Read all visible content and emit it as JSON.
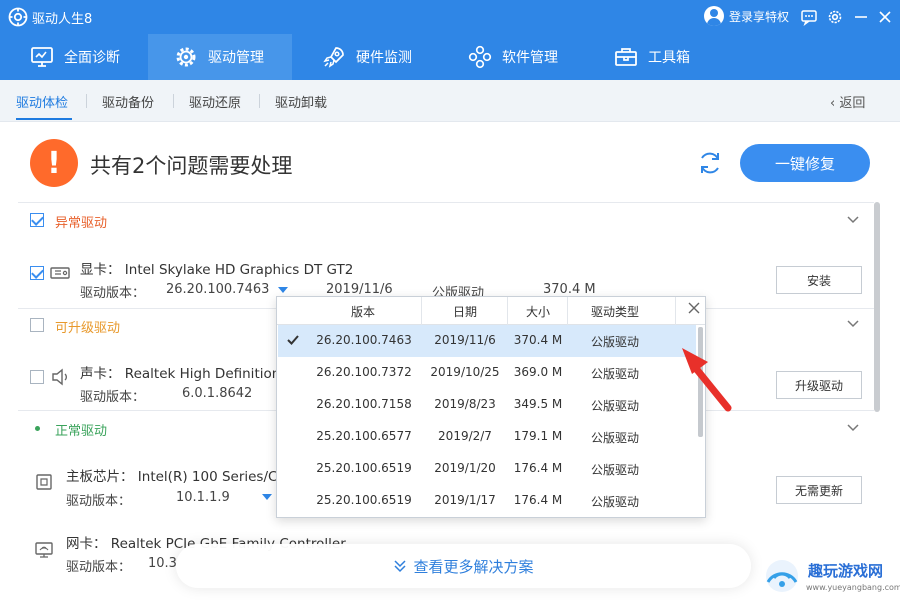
{
  "app": {
    "title": "驱动人生8",
    "login_label": "登录享特权"
  },
  "main_tabs": [
    {
      "label": "全面诊断",
      "icon": "monitor-icon"
    },
    {
      "label": "驱动管理",
      "icon": "gear-icon"
    },
    {
      "label": "硬件监测",
      "icon": "rocket-icon"
    },
    {
      "label": "软件管理",
      "icon": "apps-icon"
    },
    {
      "label": "工具箱",
      "icon": "toolbox-icon"
    }
  ],
  "active_main_tab": "驱动管理",
  "sub_tabs": [
    {
      "label": "驱动体检"
    },
    {
      "label": "驱动备份"
    },
    {
      "label": "驱动还原"
    },
    {
      "label": "驱动卸载"
    }
  ],
  "active_sub_tab": "驱动体检",
  "back_label": "返回",
  "summary": {
    "title": "共有2个问题需要处理",
    "warning_mark": "!",
    "fix_button": "一键修复"
  },
  "sections": {
    "abnormal": {
      "label": "异常驱动",
      "color": "#e8612c"
    },
    "upgradable": {
      "label": "可升级驱动",
      "color": "#e8992c"
    },
    "normal": {
      "label": "正常驱动",
      "color": "#3aa35b"
    }
  },
  "devices": {
    "graphics": {
      "label": "显卡：",
      "name": "Intel Skylake HD Graphics DT GT2",
      "version_label": "驱动版本：",
      "version": "26.20.100.7463",
      "date": "2019/11/6",
      "type": "公版驱动",
      "size": "370.4 M",
      "action": "安装"
    },
    "sound": {
      "label": "声卡：",
      "name": "Realtek High Definition",
      "version_label": "驱动版本：",
      "version": "6.0.1.8642",
      "action": "升级驱动"
    },
    "chipset": {
      "label": "主板芯片：",
      "name": "Intel(R) 100 Series/C",
      "version_label": "驱动版本：",
      "version": "10.1.1.9",
      "action": "无需更新"
    },
    "network": {
      "label": "网卡：",
      "name": "Realtek PCIe GbE Family Controller",
      "version_label": "驱动版本：",
      "version": "10.3"
    }
  },
  "version_popup": {
    "headers": [
      "版本",
      "日期",
      "大小",
      "驱动类型"
    ],
    "rows": [
      {
        "version": "26.20.100.7463",
        "date": "2019/11/6",
        "size": "370.4 M",
        "type": "公版驱动",
        "selected": true
      },
      {
        "version": "26.20.100.7372",
        "date": "2019/10/25",
        "size": "369.0 M",
        "type": "公版驱动",
        "selected": false
      },
      {
        "version": "26.20.100.7158",
        "date": "2019/8/23",
        "size": "349.5 M",
        "type": "公版驱动",
        "selected": false
      },
      {
        "version": "25.20.100.6577",
        "date": "2019/2/7",
        "size": "179.1 M",
        "type": "公版驱动",
        "selected": false
      },
      {
        "version": "25.20.100.6519",
        "date": "2019/1/20",
        "size": "176.4 M",
        "type": "公版驱动",
        "selected": false
      },
      {
        "version": "25.20.100.6519",
        "date": "2019/1/17",
        "size": "176.4 M",
        "type": "公版驱动",
        "selected": false
      }
    ]
  },
  "more_solutions": "查看更多解决方案",
  "watermark": {
    "name": "趣玩游戏网",
    "url": "www.yueyangbang.com"
  },
  "colors": {
    "brand_blue": "#2f86e6",
    "warning_orange": "#ff6a2b",
    "arrow_red": "#e8302a"
  }
}
